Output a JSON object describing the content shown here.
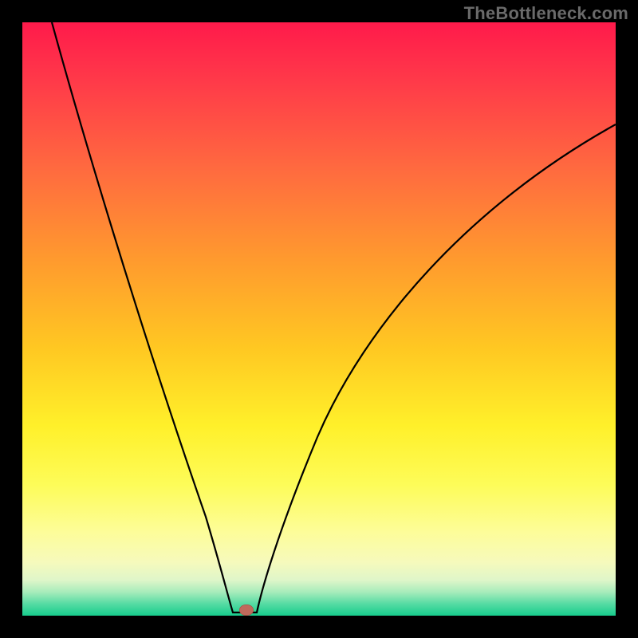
{
  "watermark": "TheBottleneck.com",
  "marker": {
    "x_pct": 37.8,
    "y_pct": 99.1
  },
  "colors": {
    "frame_bg": "#000000",
    "curve": "#000000",
    "marker": "#c06a5c",
    "gradient_stops": [
      "#ff1a4b",
      "#ff3a49",
      "#ff6b3f",
      "#ff9a2e",
      "#ffc822",
      "#fff02a",
      "#fdfc59",
      "#fdfd9a",
      "#f6fabc",
      "#dff6c9",
      "#a8ecbb",
      "#56dba3",
      "#17cd8d"
    ]
  },
  "chart_data": {
    "type": "line",
    "title": "",
    "xlabel": "",
    "ylabel": "",
    "xlim": [
      0,
      100
    ],
    "ylim": [
      0,
      100
    ],
    "grid": false,
    "series": [
      {
        "name": "bottleneck-curve-left",
        "x": [
          5,
          8,
          12,
          16,
          20,
          24,
          28,
          31,
          33,
          34.5,
          35.5
        ],
        "y": [
          100,
          88,
          74,
          60,
          47,
          34,
          22,
          12,
          5,
          1.5,
          0.3
        ]
      },
      {
        "name": "floor-segment",
        "x": [
          35.5,
          39.5
        ],
        "y": [
          0.3,
          0.3
        ]
      },
      {
        "name": "bottleneck-curve-right",
        "x": [
          39.5,
          41,
          44,
          48,
          53,
          59,
          66,
          74,
          83,
          92,
          100
        ],
        "y": [
          0.3,
          3,
          12,
          25,
          38,
          50,
          60,
          68,
          74,
          79,
          83
        ]
      }
    ],
    "annotations": [
      {
        "type": "marker",
        "name": "optimal-point",
        "x": 37.8,
        "y": 0.9
      }
    ]
  }
}
